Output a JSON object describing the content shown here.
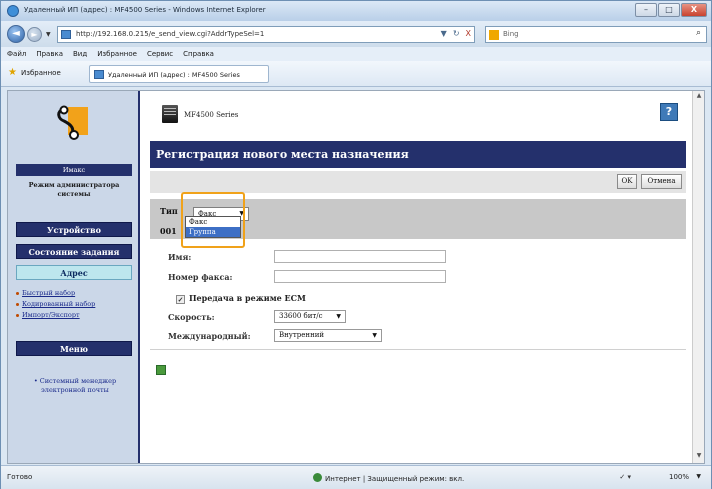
{
  "window": {
    "title": "Удаленный ИП (адрес) : MF4500 Series - Windows Internet Explorer",
    "min": "–",
    "max": "□",
    "close": "X"
  },
  "address_bar": {
    "url": "http://192.168.0.215/e_send_view.cgi?AddrTypeSel=1",
    "back": "◄",
    "forward": "►",
    "dropdown": "▼",
    "refresh": "↻",
    "stop": "X",
    "search_placeholder": "Bing",
    "search_icon": "⌕"
  },
  "menu": [
    "Файл",
    "Правка",
    "Вид",
    "Избранное",
    "Сервис",
    "Справка"
  ],
  "favorites": {
    "label": "Избранное",
    "tab_label": "Удаленный ИП (адрес) : MF4500 Series"
  },
  "sidebar": {
    "user": "Имакс",
    "mode": "Режим администратора системы",
    "buttons": {
      "device": "Устройство",
      "job_status": "Состояние задания",
      "address": "Адрес",
      "menu": "Меню"
    },
    "links": [
      "Быстрый набор",
      "Кодированный набор",
      "Импорт/Экспорт"
    ],
    "bottom_link": "Системный менеджер электронной почты"
  },
  "main": {
    "model": "MF4500 Series",
    "help": "?",
    "title": "Регистрация нового места назначения",
    "ok": "OK",
    "cancel": "Отмена",
    "type_label": "Тип",
    "type_value": "Факс",
    "type_options": [
      "Факс",
      "Группа"
    ],
    "number_prefix": "001",
    "name_label": "Имя:",
    "fax_number_label": "Номер факса:",
    "ecm_label": "Передача в режиме ECM",
    "ecm_check": "✓",
    "speed_label": "Скорость:",
    "speed_value": "33600 бит/с",
    "international_label": "Международный:",
    "international_value": "Внутренний",
    "arrow": "▼"
  },
  "status_bar": {
    "left": "Готово",
    "zone": "Интернет | Защищенный режим: вкл.",
    "security": "✓ ▾",
    "zoom": "100%",
    "zoom_arrow": "▼"
  },
  "colors": {
    "header_bg": "#24306c",
    "active_tab": "#bde6ee",
    "highlight": "#f0a21a"
  }
}
